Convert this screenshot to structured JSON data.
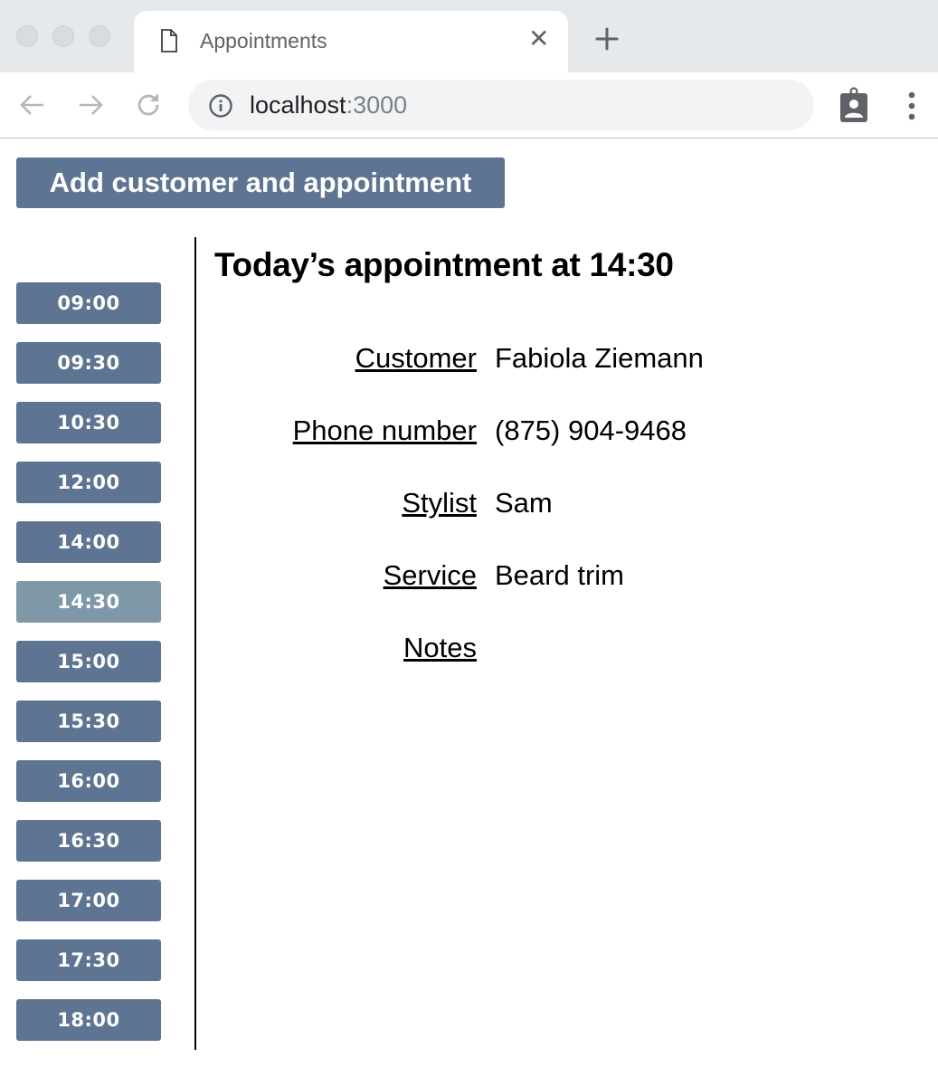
{
  "browser": {
    "tab_title": "Appointments",
    "tab_close_glyph": "✕",
    "url_host": "localhost",
    "url_port": ":3000",
    "icons": [
      "file-icon",
      "close-icon",
      "plus-icon",
      "back-icon",
      "forward-icon",
      "reload-icon",
      "info-icon",
      "badge-extension-icon",
      "kebab-menu-icon"
    ]
  },
  "page": {
    "add_button_label": "Add customer and appointment",
    "time_slots": [
      {
        "label": "09:00",
        "selected": false
      },
      {
        "label": "09:30",
        "selected": false
      },
      {
        "label": "10:30",
        "selected": false
      },
      {
        "label": "12:00",
        "selected": false
      },
      {
        "label": "14:00",
        "selected": false
      },
      {
        "label": "14:30",
        "selected": true
      },
      {
        "label": "15:00",
        "selected": false
      },
      {
        "label": "15:30",
        "selected": false
      },
      {
        "label": "16:00",
        "selected": false
      },
      {
        "label": "16:30",
        "selected": false
      },
      {
        "label": "17:00",
        "selected": false
      },
      {
        "label": "17:30",
        "selected": false
      },
      {
        "label": "18:00",
        "selected": false
      }
    ],
    "appointment": {
      "heading": "Today’s appointment at 14:30",
      "fields": [
        {
          "label": "Customer",
          "value": "Fabiola Ziemann"
        },
        {
          "label": "Phone number",
          "value": "(875) 904-9468"
        },
        {
          "label": "Stylist",
          "value": "Sam"
        },
        {
          "label": "Service",
          "value": "Beard trim"
        },
        {
          "label": "Notes",
          "value": ""
        }
      ]
    }
  },
  "colors": {
    "button": "#5d7592",
    "button_selected": "#7f98a8",
    "button_text": "#ffffff"
  }
}
